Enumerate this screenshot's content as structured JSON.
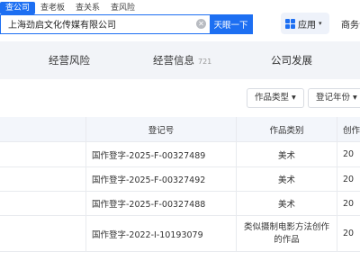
{
  "search": {
    "tabs": [
      "查公司",
      "查老板",
      "查关系",
      "查风险"
    ],
    "value": "上海劲启文化传媒有限公司",
    "button_label": "天眼一下"
  },
  "header": {
    "app_label": "应用",
    "business_label": "商务合作"
  },
  "nav": {
    "tabs": [
      {
        "label": "经营风险",
        "count": ""
      },
      {
        "label": "经营信息",
        "count": "721"
      },
      {
        "label": "公司发展",
        "count": ""
      }
    ]
  },
  "filters": {
    "work_type": "作品类型",
    "reg_year": "登记年份"
  },
  "table": {
    "headers": [
      "",
      "登记号",
      "作品类别",
      "创作"
    ],
    "rows": [
      {
        "reg_no": "国作登字-2025-F-00327489",
        "category": "美术",
        "year": "20"
      },
      {
        "reg_no": "国作登字-2025-F-00327492",
        "category": "美术",
        "year": "20"
      },
      {
        "reg_no": "国作登字-2025-F-00327488",
        "category": "美术",
        "year": "20"
      },
      {
        "reg_no": "国作登字-2022-I-10193079",
        "category": "类似摄制电影方法创作的作品",
        "year": "20"
      }
    ]
  }
}
